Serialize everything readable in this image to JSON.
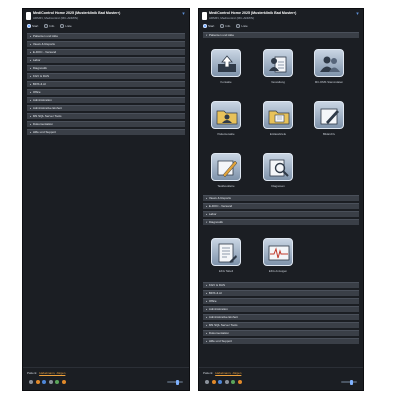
{
  "left": {
    "title": "MediControl Home 2025 (Musterklinik Bad Musterr)",
    "subtitle": "ADMIN, Medicontrol (MC-ADMIN)",
    "modes": [
      "Start",
      "Info",
      "Liste"
    ],
    "sections": [
      "Patienten und Akte",
      "Views & Reports",
      "E-DOC - Versand",
      "Labor",
      "Diagnostik",
      "KGV & DAS",
      "BFIS & AI",
      "Office",
      "Administration",
      "Administrative Einheit",
      "MS SQL Server Tools",
      "Dokumentation",
      "Hilfe und Support"
    ],
    "footer": {
      "patient_label": "Patient:",
      "patient_name": "Habelmann, Jürgen"
    }
  },
  "right": {
    "title": "MediControl Home 2025 (Musterklinik Bad Musterr)",
    "subtitle": "ADMIN, Medicontrol (MC-ADMIN)",
    "modes": [
      "Start",
      "Info",
      "Liste"
    ],
    "section_open": "Patienten und Akte",
    "tiles_group1": [
      {
        "label": "Kontakte",
        "icon": "export-icon"
      },
      {
        "label": "Verwaltung",
        "icon": "document-user-icon"
      },
      {
        "label": "MC-DMS Stammdaten",
        "icon": "users-icon"
      },
      {
        "label": "Patientenakte",
        "icon": "folder-patient-icon"
      },
      {
        "label": "Entlassbriefe",
        "icon": "folder-icon"
      },
      {
        "label": "Bildarchiv",
        "icon": "pen-icon"
      },
      {
        "label": "Taskbookletre",
        "icon": "pen-board-icon"
      },
      {
        "label": "Diagnosen",
        "icon": "magnifier-icon"
      }
    ],
    "sections_mid": [
      "Views & Reports",
      "E-DOC - Versand",
      "Labor",
      "Diagnostik"
    ],
    "tiles_group2": [
      {
        "label": "EKG Tabell",
        "icon": "chart-doc-icon"
      },
      {
        "label": "EKG Anzeigen",
        "icon": "ecg-icon"
      }
    ],
    "sections_bottom": [
      "KGV & DAS",
      "BFIS & AI",
      "Office",
      "Administration",
      "Administrative Einheit",
      "MS SQL Server Tools",
      "Dokumentation",
      "Hilfe und Support"
    ],
    "footer": {
      "patient_label": "Patient:",
      "patient_name": "Habelmann, Jürgen"
    }
  }
}
